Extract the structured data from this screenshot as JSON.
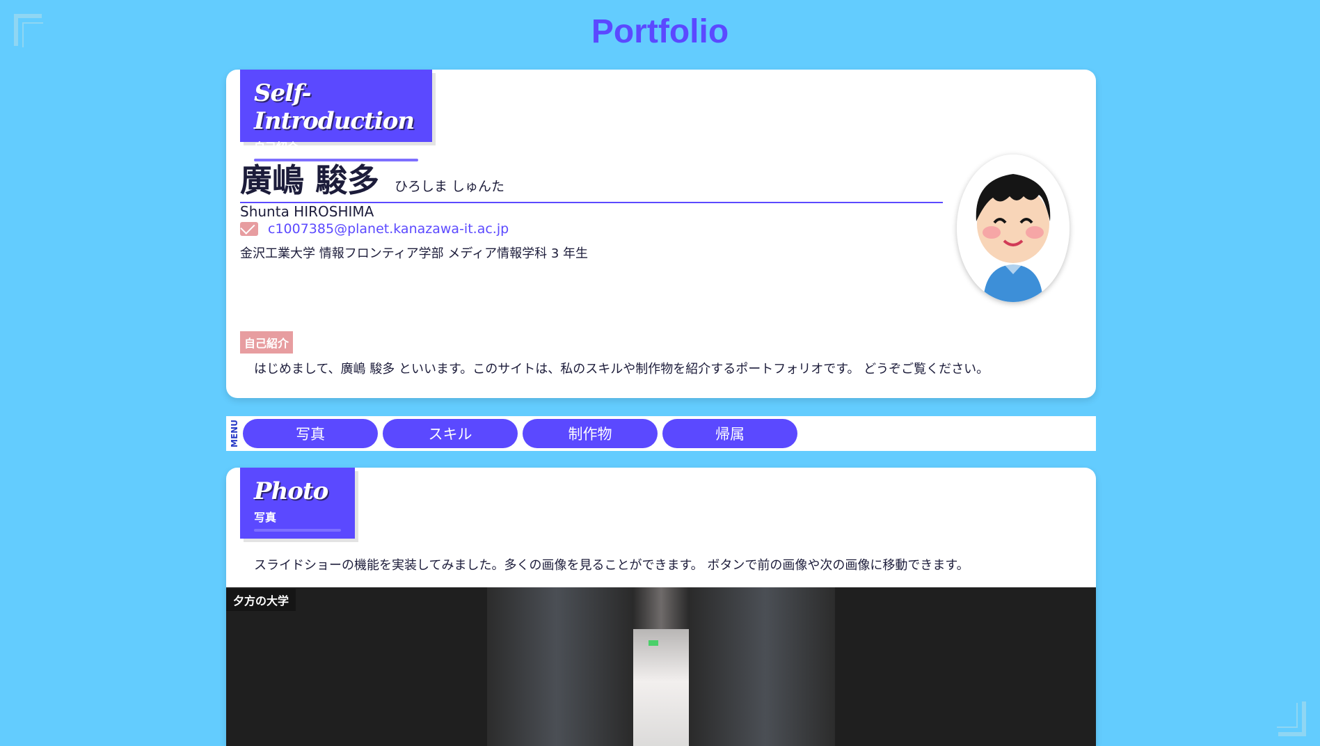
{
  "site": {
    "title": "Portfolio"
  },
  "intro": {
    "tag_en": "Self-Introduction",
    "tag_jp": "自己紹介",
    "name": "廣嶋 駿多",
    "name_kana": "ひろしま しゅんた",
    "name_en": "Shunta HIROSHIMA",
    "email": "c1007385@planet.kanazawa-it.ac.jp",
    "affiliation": "金沢工業大学 情報フロンティア学部 メディア情報学科 3 年生",
    "badge": "自己紹介",
    "text": "はじめまして、廣嶋 駿多 といいます。このサイトは、私のスキルや制作物を紹介するポートフォリオです。 どうぞご覧ください。"
  },
  "menu": {
    "label": "MENU",
    "items": [
      "写真",
      "スキル",
      "制作物",
      "帰属"
    ]
  },
  "photo": {
    "tag_en": "Photo",
    "tag_jp": "写真",
    "description": "スライドショーの機能を実装してみました。多くの画像を見ることができます。 ボタンで前の画像や次の画像に移動できます。",
    "slide_caption": "夕方の大学"
  },
  "colors": {
    "background": "#63ccfe",
    "accent": "#5b49ff",
    "badge": "#e79da0"
  },
  "icons": {
    "email": "mail-icon",
    "avatar": "avatar-illustration"
  }
}
